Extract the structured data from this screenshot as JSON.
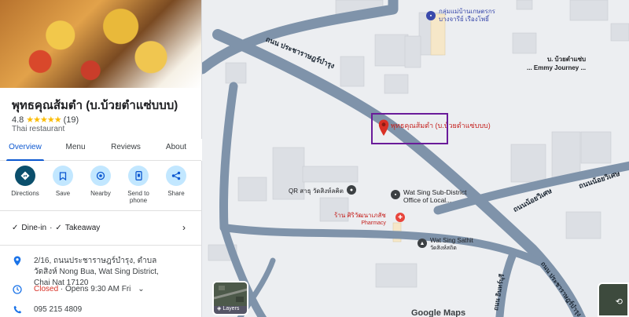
{
  "place": {
    "name": "พุทธคุณส้มตำ (บ.บ้วยตำแซ่บบบ)",
    "rating": "4.8",
    "reviews": "(19)",
    "category": "Thai restaurant"
  },
  "tabs": [
    "Overview",
    "Menu",
    "Reviews",
    "About"
  ],
  "actions": [
    {
      "label": "Directions",
      "icon": "directions-icon"
    },
    {
      "label": "Save",
      "icon": "bookmark-icon"
    },
    {
      "label": "Nearby",
      "icon": "nearby-icon"
    },
    {
      "label": "Send to phone",
      "icon": "phone-icon"
    },
    {
      "label": "Share",
      "icon": "share-icon"
    }
  ],
  "services": {
    "dine_in": "Dine-in",
    "sep": "·",
    "takeaway": "Takeaway"
  },
  "address": "2/16, ถนนประชาราษฎร์บำรุง, ตำบลวัดสิงห์ Nong Bua, Wat Sing District, Chai Nat 17120",
  "hours": {
    "status": "Closed",
    "detail": "· Opens 9:30 AM Fri"
  },
  "phone": "095 215 4809",
  "map": {
    "roads": {
      "main_road": "ถนน ประชาราษฎร์บำรุง",
      "noi_wiset": "ถนนน้อยวิเศษ",
      "noi_wiset_2": "ถนนน้อยวิเศษ",
      "bottom_road": "ถนน ประชาราษฎร์บำรุง",
      "lower_left": "ถนน อินทร์บุรี"
    },
    "marker_label": "พุทธคุณส้มตำ (บ.บ้วยตำแซ่บบบ)",
    "pois": {
      "farmer_group": [
        "กลุ่มแม่บ้านเกษตรกร",
        "บางจารีย์ เรืองโพธิ์"
      ],
      "emmy": [
        "บ. บ้วยตำแซ่บ",
        "... Emmy Journey ..."
      ],
      "qr_shop": "QR สาธุ วัดสิงห์ลคิต",
      "district_office": [
        "Wat Sing Sub-District",
        "Office of Local..."
      ],
      "pharmacy": [
        "ร้าน ศิริวัฒนาเภสัช",
        "Pharmacy"
      ],
      "wat_sing_sathit": [
        "Wat Sing Sathit",
        "วัดสิงห์สถิต"
      ]
    },
    "layers_label": "Layers",
    "logo": "Google Maps"
  },
  "colors": {
    "accent": "#0b57d0",
    "marker": "#d93025",
    "highlight": "#6a1b9a",
    "road": "#7f93aa"
  }
}
